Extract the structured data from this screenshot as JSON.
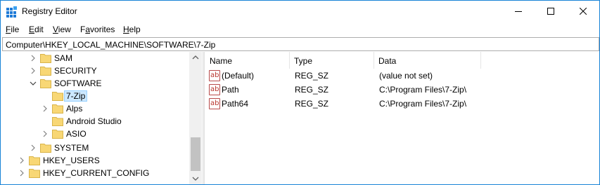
{
  "window": {
    "title": "Registry Editor"
  },
  "menu": [
    "File",
    "Edit",
    "View",
    "Favorites",
    "Help"
  ],
  "menu_underline": [
    "F",
    "E",
    "V",
    "a",
    "H"
  ],
  "address": "Computer\\HKEY_LOCAL_MACHINE\\SOFTWARE\\7-Zip",
  "tree": [
    {
      "label": "SAM",
      "expander": "collapsed"
    },
    {
      "label": "SECURITY",
      "expander": "collapsed"
    },
    {
      "label": "SOFTWARE",
      "expander": "expanded"
    },
    {
      "label": "7-Zip",
      "expander": "none",
      "selected": true
    },
    {
      "label": "Alps",
      "expander": "collapsed"
    },
    {
      "label": "Android Studio",
      "expander": "none"
    },
    {
      "label": "ASIO",
      "expander": "collapsed"
    },
    {
      "label": "SYSTEM",
      "expander": "collapsed"
    },
    {
      "label": "HKEY_USERS",
      "expander": "collapsed"
    },
    {
      "label": "HKEY_CURRENT_CONFIG",
      "expander": "collapsed"
    }
  ],
  "columns": [
    "Name",
    "Type",
    "Data"
  ],
  "values": [
    {
      "icon": "string-value-icon",
      "icon_text": "ab",
      "name": "(Default)",
      "type": "REG_SZ",
      "data": "(value not set)"
    },
    {
      "icon": "string-value-icon",
      "icon_text": "ab",
      "name": "Path",
      "type": "REG_SZ",
      "data": "C:\\Program Files\\7-Zip\\"
    },
    {
      "icon": "string-value-icon",
      "icon_text": "ab",
      "name": "Path64",
      "type": "REG_SZ",
      "data": "C:\\Program Files\\7-Zip\\"
    }
  ],
  "colors": {
    "accent_border": "#1883d7",
    "selection": "#cce8ff",
    "folder": "#f8d775"
  }
}
